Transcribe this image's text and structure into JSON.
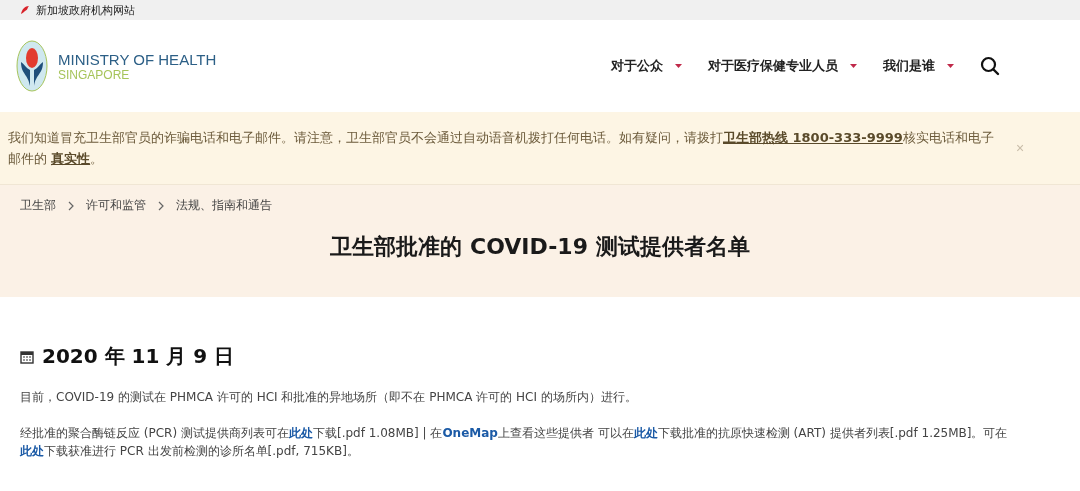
{
  "gov_bar": {
    "text": "新加坡政府机构网站"
  },
  "header": {
    "logo_title": "MINISTRY OF HEALTH",
    "logo_subtitle": "SINGAPORE",
    "nav": [
      {
        "label": "对于公众",
        "expanded": false
      },
      {
        "label": "对于医疗保健专业人员",
        "expanded": false
      },
      {
        "label": "我们是谁",
        "expanded": false
      }
    ]
  },
  "alert": {
    "segments": [
      {
        "kind": "text",
        "text": "我们知道冒充卫生部官员的诈骗电话和电子邮件。请注意，卫生部官员不会通过自动语音机拨打任何电话。如有疑问，请拨打"
      },
      {
        "kind": "link",
        "text": "卫生部热线 1800-333-9999"
      },
      {
        "kind": "text",
        "text": "核实电话和电子邮件的 "
      },
      {
        "kind": "link",
        "text": "真实性"
      },
      {
        "kind": "text",
        "text": "。"
      }
    ],
    "close": "×"
  },
  "breadcrumb": [
    {
      "label": "卫生部"
    },
    {
      "label": "许可和监管"
    },
    {
      "label": "法规、指南和通告"
    }
  ],
  "page_title": "卫生部批准的 COVID-19 测试提供者名单",
  "date": "2020 年 11 月 9 日",
  "paragraphs": [
    [
      {
        "kind": "text",
        "text": "目前，COVID-19 的测试在 PHMCA 许可的 HCI 和批准的异地场所（即不在 PHMCA 许可的 HCI 的场所内）进行。"
      }
    ],
    [
      {
        "kind": "text",
        "text": "经批准的聚合酶链反应 (PCR) 测试提供商列表可在"
      },
      {
        "kind": "link",
        "text": "此处"
      },
      {
        "kind": "text",
        "text": "下载[.pdf 1.08MB] | 在"
      },
      {
        "kind": "link",
        "text": "OneMap"
      },
      {
        "kind": "text",
        "text": "上查看这些提供者 可以在"
      },
      {
        "kind": "link",
        "text": "此处"
      },
      {
        "kind": "text",
        "text": "下载批准的抗原快速检测 (ART) 提供者列表[.pdf 1.25MB]。可在"
      },
      {
        "kind": "link",
        "text": "此处"
      },
      {
        "kind": "text",
        "text": "下载获准进行 PCR 出发前检测的诊所名单[.pdf, 715KB]。"
      }
    ]
  ]
}
